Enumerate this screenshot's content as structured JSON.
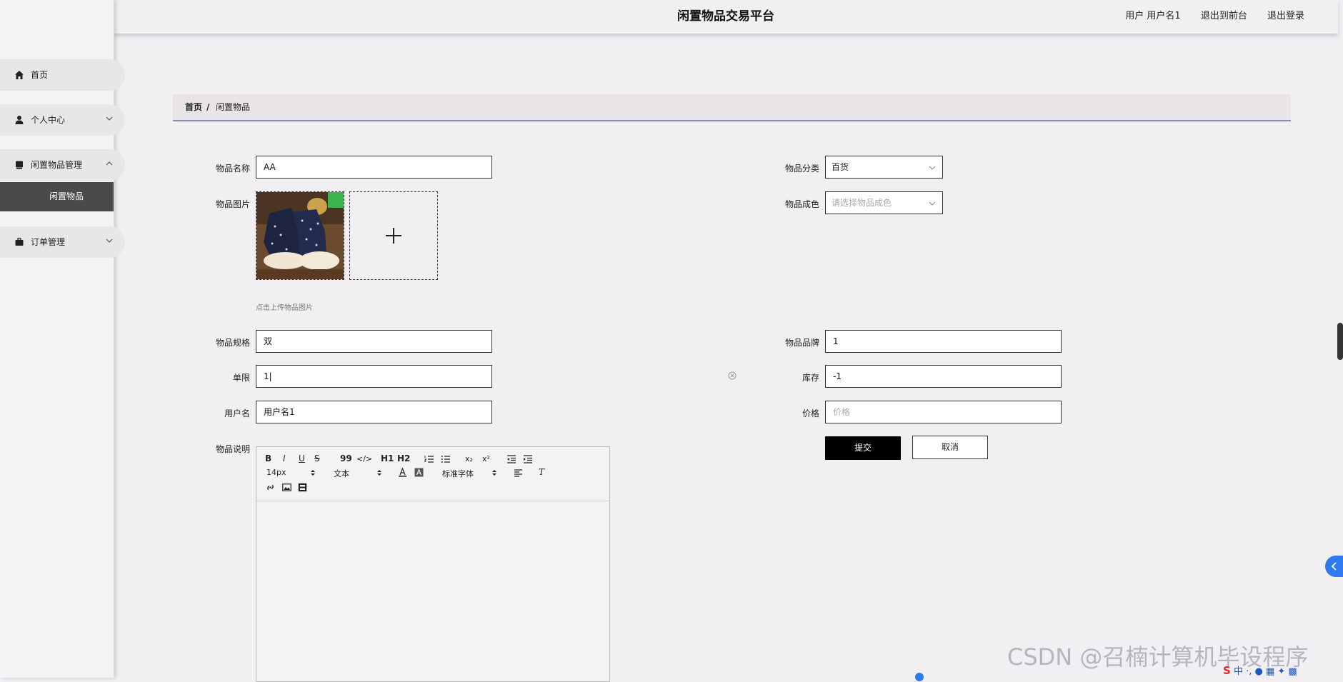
{
  "app": {
    "title": "闲置物品交易平台"
  },
  "topbar": {
    "user_label": "用户 用户名1",
    "back_to_front": "退出到前台",
    "logout": "退出登录"
  },
  "sidebar": {
    "items": [
      {
        "label": "首页",
        "icon": "home-icon"
      },
      {
        "label": "个人中心",
        "icon": "user-icon",
        "expandable": true
      },
      {
        "label": "闲置物品管理",
        "icon": "item-icon",
        "expandable": true,
        "expanded": true
      },
      {
        "label": "订单管理",
        "icon": "briefcase-icon",
        "expandable": true
      }
    ],
    "submenu_active": "闲置物品"
  },
  "breadcrumb": {
    "home": "首页",
    "separator": "/",
    "current": "闲置物品"
  },
  "form": {
    "name": {
      "label": "物品名称",
      "value": "AA"
    },
    "category": {
      "label": "物品分类",
      "value": "百货"
    },
    "image": {
      "label": "物品图片",
      "hint": "点击上传物品图片"
    },
    "condition": {
      "label": "物品成色",
      "placeholder": "请选择物品成色"
    },
    "spec": {
      "label": "物品规格",
      "value": "双"
    },
    "brand": {
      "label": "物品品牌",
      "value": "1"
    },
    "limit": {
      "label": "单限",
      "value": "1|"
    },
    "stock": {
      "label": "库存",
      "value": "-1"
    },
    "username": {
      "label": "用户名",
      "value": "用户名1"
    },
    "price": {
      "label": "价格",
      "placeholder": "价格"
    },
    "description": {
      "label": "物品说明"
    },
    "submit": "提交",
    "cancel": "取消"
  },
  "editor": {
    "font_size": "14px",
    "block_type": "文本",
    "font_family": "标准字体",
    "toolbar_row1": [
      "B",
      "I",
      "U",
      "S",
      "99",
      "</>",
      "H1",
      "H2",
      "ol",
      "ul",
      "x₂",
      "x²",
      "outdent",
      "indent"
    ],
    "toolbar_icons": [
      "bold-icon",
      "italic-icon",
      "underline-icon",
      "strike-icon",
      "quote-icon",
      "code-icon",
      "h1-icon",
      "h2-icon",
      "ordered-list-icon",
      "bullet-list-icon",
      "subscript-icon",
      "superscript-icon",
      "outdent-icon",
      "indent-icon",
      "font-color-icon",
      "bg-color-icon",
      "align-icon",
      "clear-format-icon",
      "link-icon",
      "image-icon",
      "video-icon"
    ]
  },
  "watermark": "CSDN @召楠计算机毕设程序",
  "ime": {
    "logo": "S",
    "lang": "中"
  },
  "colors": {
    "accent": "#000000",
    "breadcrumb_line": "#8a8cb5",
    "sidebar_active": "#4a4a4a",
    "handle": "#2f7af0"
  }
}
